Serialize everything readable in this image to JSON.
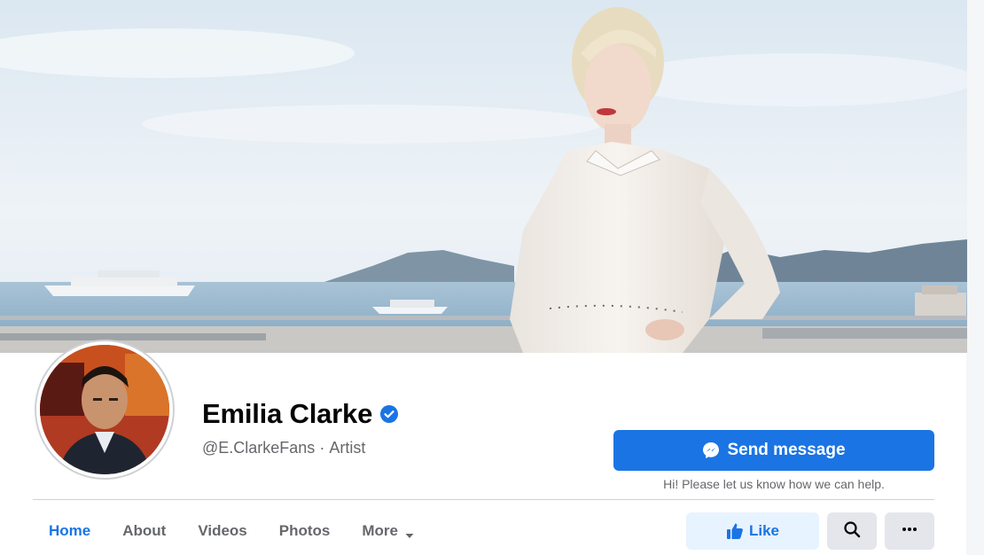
{
  "profile": {
    "name": "Emilia Clarke",
    "handle": "@E.ClarkeFans",
    "separator": "·",
    "category": "Artist",
    "verified": true
  },
  "actions": {
    "send_message_label": "Send message",
    "send_message_hint": "Hi! Please let us know how we can help.",
    "like_label": "Like"
  },
  "tabs": [
    {
      "label": "Home",
      "active": true
    },
    {
      "label": "About",
      "active": false
    },
    {
      "label": "Videos",
      "active": false
    },
    {
      "label": "Photos",
      "active": false
    },
    {
      "label": "More",
      "active": false,
      "has_dropdown": true
    }
  ],
  "icons": {
    "verified": "verified-badge-icon",
    "messenger": "messenger-icon",
    "like": "thumbs-up-icon",
    "search": "search-icon",
    "more": "ellipsis-icon",
    "dropdown": "caret-down-icon"
  },
  "colors": {
    "accent": "#1b74e4",
    "accent_light": "#e7f3ff",
    "secondary_button": "#e4e6eb",
    "text_primary": "#050505",
    "text_secondary": "#65676b"
  }
}
